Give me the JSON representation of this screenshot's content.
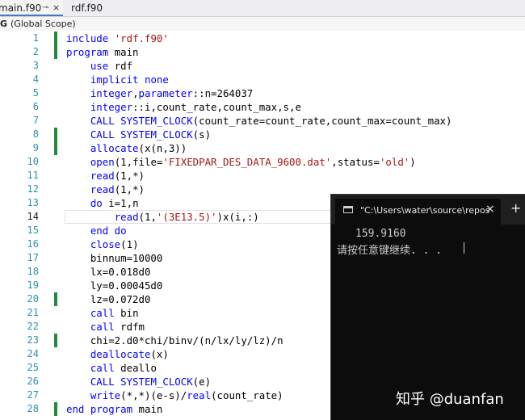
{
  "tabs": [
    {
      "label": "main.f90",
      "pin_icon": "pin-icon",
      "close_label": "×"
    },
    {
      "label": "rdf.f90"
    }
  ],
  "scope": {
    "label": "(Global Scope)"
  },
  "editor": {
    "current_line": 14,
    "lines": [
      {
        "num": "1",
        "tokens": [
          [
            "k",
            "include"
          ],
          [
            "p",
            " "
          ],
          [
            "s",
            "'rdf.f90'"
          ]
        ]
      },
      {
        "num": "2",
        "tokens": [
          [
            "k",
            "program"
          ],
          [
            "p",
            " main"
          ]
        ]
      },
      {
        "num": "3",
        "tokens": [
          [
            "p",
            "    "
          ],
          [
            "k",
            "use"
          ],
          [
            "p",
            " rdf"
          ]
        ]
      },
      {
        "num": "4",
        "tokens": [
          [
            "p",
            "    "
          ],
          [
            "k",
            "implicit none"
          ]
        ]
      },
      {
        "num": "5",
        "tokens": [
          [
            "p",
            "    "
          ],
          [
            "k",
            "integer"
          ],
          [
            "p",
            ","
          ],
          [
            "k",
            "parameter"
          ],
          [
            "p",
            "::n=264037"
          ]
        ]
      },
      {
        "num": "6",
        "tokens": [
          [
            "p",
            "    "
          ],
          [
            "k",
            "integer"
          ],
          [
            "p",
            "::i,count_rate,count_max,s,e"
          ]
        ]
      },
      {
        "num": "7",
        "tokens": [
          [
            "p",
            "    "
          ],
          [
            "k",
            "CALL SYSTEM_CLOCK"
          ],
          [
            "p",
            "(count_rate=count_rate,count_max=count_max)"
          ]
        ]
      },
      {
        "num": "8",
        "tokens": [
          [
            "p",
            "    "
          ],
          [
            "k",
            "CALL SYSTEM_CLOCK"
          ],
          [
            "p",
            "(s)"
          ]
        ]
      },
      {
        "num": "9",
        "tokens": [
          [
            "p",
            "    "
          ],
          [
            "k",
            "allocate"
          ],
          [
            "p",
            "(x(n,3))"
          ]
        ]
      },
      {
        "num": "10",
        "tokens": [
          [
            "p",
            "    "
          ],
          [
            "k",
            "open"
          ],
          [
            "p",
            "(1,file="
          ],
          [
            "s",
            "'FIXEDPAR_DES_DATA_9600.dat'"
          ],
          [
            "p",
            ",status="
          ],
          [
            "s",
            "'old'"
          ],
          [
            "p",
            ")"
          ]
        ]
      },
      {
        "num": "11",
        "tokens": [
          [
            "p",
            "    "
          ],
          [
            "k",
            "read"
          ],
          [
            "p",
            "(1,*)"
          ]
        ]
      },
      {
        "num": "12",
        "tokens": [
          [
            "p",
            "    "
          ],
          [
            "k",
            "read"
          ],
          [
            "p",
            "(1,*)"
          ]
        ]
      },
      {
        "num": "13",
        "tokens": [
          [
            "p",
            "    "
          ],
          [
            "k",
            "do"
          ],
          [
            "p",
            " i=1,n"
          ]
        ]
      },
      {
        "num": "14",
        "tokens": [
          [
            "p",
            "        "
          ],
          [
            "k",
            "read"
          ],
          [
            "p",
            "(1,"
          ],
          [
            "s",
            "'(3E13.5)'"
          ],
          [
            "p",
            ")x(i,:)"
          ]
        ]
      },
      {
        "num": "15",
        "tokens": [
          [
            "p",
            "    "
          ],
          [
            "k",
            "end do"
          ]
        ]
      },
      {
        "num": "16",
        "tokens": [
          [
            "p",
            "    "
          ],
          [
            "k",
            "close"
          ],
          [
            "p",
            "(1)"
          ]
        ]
      },
      {
        "num": "17",
        "tokens": [
          [
            "p",
            "    binnum=10000"
          ]
        ]
      },
      {
        "num": "18",
        "tokens": [
          [
            "p",
            "    lx=0.018d0"
          ]
        ]
      },
      {
        "num": "19",
        "tokens": [
          [
            "p",
            "    ly=0.00045d0"
          ]
        ]
      },
      {
        "num": "20",
        "tokens": [
          [
            "p",
            "    lz=0.072d0"
          ]
        ]
      },
      {
        "num": "21",
        "tokens": [
          [
            "p",
            "    "
          ],
          [
            "k",
            "call"
          ],
          [
            "p",
            " bin"
          ]
        ]
      },
      {
        "num": "22",
        "tokens": [
          [
            "p",
            "    "
          ],
          [
            "k",
            "call"
          ],
          [
            "p",
            " rdfm"
          ]
        ]
      },
      {
        "num": "23",
        "tokens": [
          [
            "p",
            "    chi=2.d0*chi/binv/(n/lx/ly/lz)/n"
          ]
        ]
      },
      {
        "num": "24",
        "tokens": [
          [
            "p",
            "    "
          ],
          [
            "k",
            "deallocate"
          ],
          [
            "p",
            "(x)"
          ]
        ]
      },
      {
        "num": "25",
        "tokens": [
          [
            "p",
            "    "
          ],
          [
            "k",
            "call"
          ],
          [
            "p",
            " deallo"
          ]
        ]
      },
      {
        "num": "26",
        "tokens": [
          [
            "p",
            "    "
          ],
          [
            "k",
            "CALL SYSTEM_CLOCK"
          ],
          [
            "p",
            "(e)"
          ]
        ]
      },
      {
        "num": "27",
        "tokens": [
          [
            "p",
            "    "
          ],
          [
            "k",
            "write"
          ],
          [
            "p",
            "(*,*)(e-s)/"
          ],
          [
            "k",
            "real"
          ],
          [
            "p",
            "(count_rate)"
          ]
        ]
      },
      {
        "num": "28",
        "tokens": [
          [
            "k",
            "end program"
          ],
          [
            "p",
            " main"
          ]
        ]
      }
    ],
    "changed_lines": [
      1,
      2,
      8,
      9,
      20,
      23,
      28
    ],
    "colors": {
      "keyword": "#0000ff",
      "string": "#a31515",
      "line_number": "#2b91af",
      "change_bar": "#1f8c3a"
    }
  },
  "console": {
    "title": "\"C:\\Users\\water\\source\\repos",
    "close_label": "×",
    "new_tab_label": "+",
    "output_value": "159.9160",
    "prompt": "请按任意键继续. . ."
  },
  "watermark": {
    "text": "知乎 @duanfan"
  }
}
